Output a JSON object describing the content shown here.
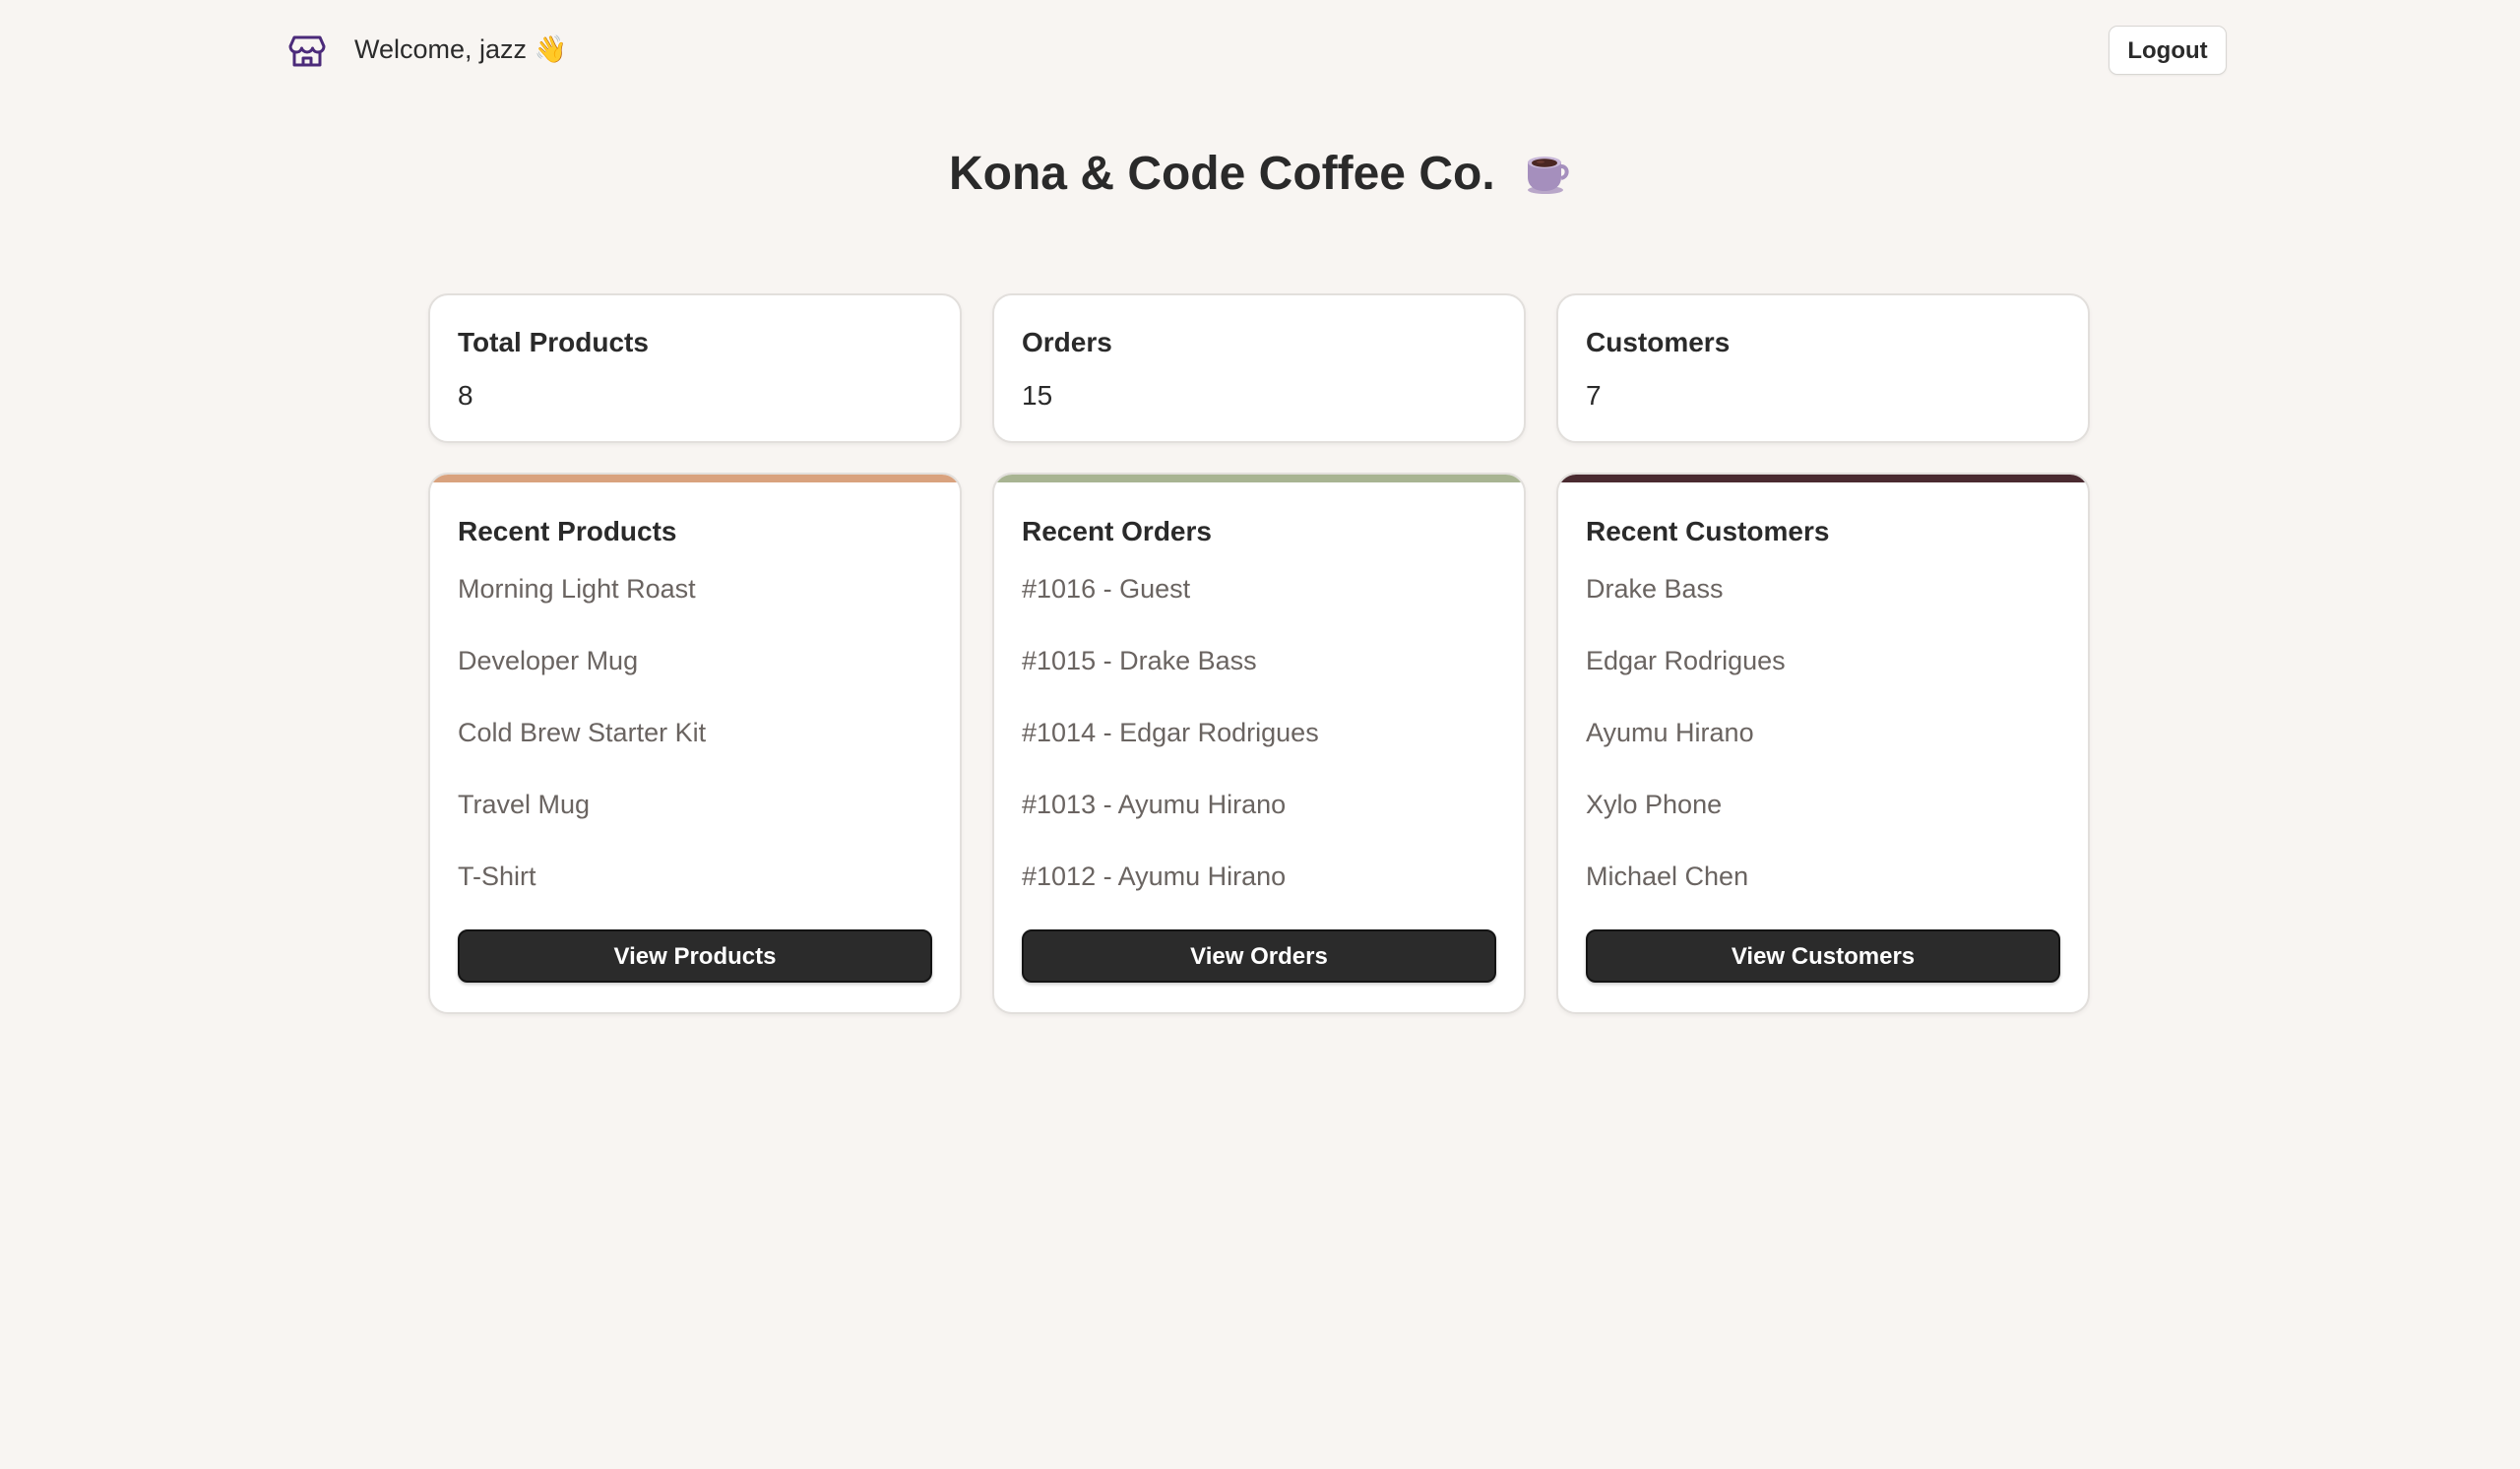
{
  "header": {
    "welcome_text": "Welcome, jazz 👋",
    "logout_label": "Logout",
    "icon": "store-icon"
  },
  "page": {
    "title": "Kona & Code Coffee Co.",
    "title_icon": "coffee-cup-icon"
  },
  "stats": [
    {
      "label": "Total Products",
      "value": "8"
    },
    {
      "label": "Orders",
      "value": "15"
    },
    {
      "label": "Customers",
      "value": "7"
    }
  ],
  "sections": [
    {
      "title": "Recent Products",
      "accent_color": "#d9a27e",
      "items": [
        "Morning Light Roast",
        "Developer Mug",
        "Cold Brew Starter Kit",
        "Travel Mug",
        "T-Shirt"
      ],
      "button_label": "View Products"
    },
    {
      "title": "Recent Orders",
      "accent_color": "#a8b492",
      "items": [
        "#1016 - Guest",
        "#1015 - Drake Bass",
        "#1014 - Edgar Rodrigues",
        "#1013 - Ayumu Hirano",
        "#1012 - Ayumu Hirano"
      ],
      "button_label": "View Orders"
    },
    {
      "title": "Recent Customers",
      "accent_color": "#4a2a30",
      "items": [
        "Drake Bass",
        "Edgar Rodrigues",
        "Ayumu Hirano",
        "Xylo Phone",
        "Michael Chen"
      ],
      "button_label": "View Customers"
    }
  ],
  "colors": {
    "background": "#f8f5f2",
    "button_dark": "#2b2b2b",
    "icon_purple": "#4b2a7a"
  }
}
